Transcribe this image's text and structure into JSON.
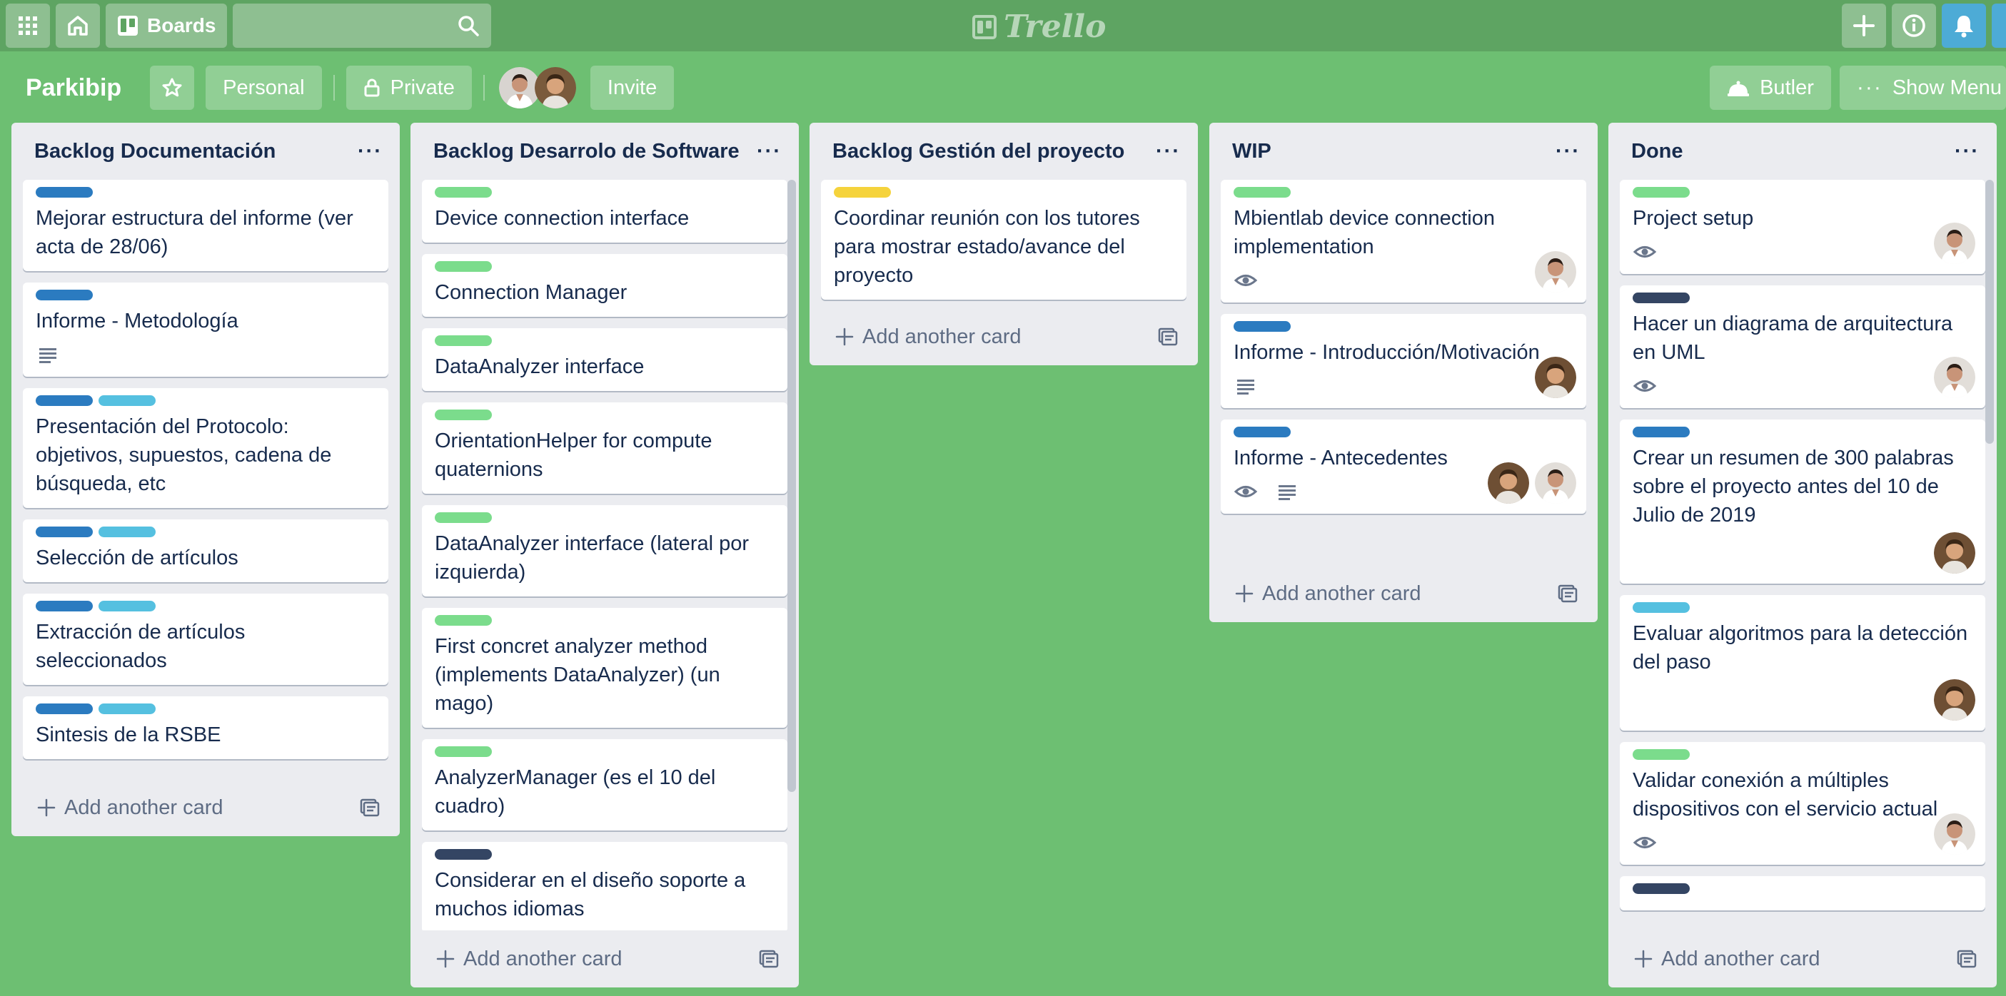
{
  "topbar": {
    "boards_label": "Boards",
    "logo_text": "Trello",
    "icons": [
      "apps-icon",
      "home-icon",
      "boards-icon",
      "search-icon",
      "plus-icon",
      "info-icon",
      "bell-icon"
    ]
  },
  "board": {
    "name": "Parkibip",
    "team_label": "Personal",
    "visibility_label": "Private",
    "invite_label": "Invite",
    "butler_label": "Butler",
    "show_menu_label": "Show Menu",
    "background_color": "#6dbf72"
  },
  "label_colors": {
    "blue": "#0079bf",
    "green": "#61bd4f",
    "sky": "#00c2e0",
    "yellow": "#f2d600",
    "navy": "#344563"
  },
  "lists": [
    {
      "title": "Backlog Documentación",
      "add_label": "Add another card",
      "cards": [
        {
          "labels": [
            "#2b7bc0"
          ],
          "text": "Mejorar estructura del informe (ver acta de 28/06)",
          "badges": [],
          "avatars": []
        },
        {
          "labels": [
            "#2b7bc0"
          ],
          "text": "Informe - Metodología",
          "badges": [
            "description-icon"
          ],
          "avatars": []
        },
        {
          "labels": [
            "#2b7bc0",
            "#55c0e0"
          ],
          "text": "Presentación del Protocolo: objetivos, supuestos, cadena de búsqueda, etc",
          "badges": [],
          "avatars": []
        },
        {
          "labels": [
            "#2b7bc0",
            "#55c0e0"
          ],
          "text": "Selección de artículos",
          "badges": [],
          "avatars": []
        },
        {
          "labels": [
            "#2b7bc0",
            "#55c0e0"
          ],
          "text": "Extracción de artículos seleccionados",
          "badges": [],
          "avatars": []
        },
        {
          "labels": [
            "#2b7bc0",
            "#55c0e0"
          ],
          "text": "Sintesis de la RSBE",
          "badges": [],
          "avatars": []
        }
      ]
    },
    {
      "title": "Backlog Desarrolo de Software",
      "add_label": "Add another card",
      "cards": [
        {
          "labels": [
            "#7bdc8c"
          ],
          "text": "Device connection interface",
          "badges": [],
          "avatars": []
        },
        {
          "labels": [
            "#7bdc8c"
          ],
          "text": "Connection Manager",
          "badges": [],
          "avatars": []
        },
        {
          "labels": [
            "#7bdc8c"
          ],
          "text": "DataAnalyzer interface",
          "badges": [],
          "avatars": []
        },
        {
          "labels": [
            "#7bdc8c"
          ],
          "text": "OrientationHelper for compute quaternions",
          "badges": [],
          "avatars": []
        },
        {
          "labels": [
            "#7bdc8c"
          ],
          "text": "DataAnalyzer interface (lateral por izquierda)",
          "badges": [],
          "avatars": []
        },
        {
          "labels": [
            "#7bdc8c"
          ],
          "text": "First concret analyzer method (implements DataAnalyzer) (un mago)",
          "badges": [],
          "avatars": []
        },
        {
          "labels": [
            "#7bdc8c"
          ],
          "text": "AnalyzerManager (es el 10 del cuadro)",
          "badges": [],
          "avatars": []
        },
        {
          "labels": [
            "#344563"
          ],
          "text": "Considerar en el diseño soporte a muchos idiomas",
          "badges": [],
          "avatars": []
        }
      ]
    },
    {
      "title": "Backlog Gestión del proyecto",
      "add_label": "Add another card",
      "cards": [
        {
          "labels": [
            "#f5d33c"
          ],
          "text": "Coordinar reunión con los tutores para mostrar estado/avance del proyecto",
          "badges": [],
          "avatars": []
        }
      ]
    },
    {
      "title": "WIP",
      "add_label": "Add another card",
      "cards": [
        {
          "labels": [
            "#7bdc8c"
          ],
          "text": "Mbientlab device connection implementation",
          "badges": [
            "watch-icon"
          ],
          "avatars": [
            "a"
          ]
        },
        {
          "labels": [
            "#2b7bc0"
          ],
          "text": "Informe - Introducción/Motivación",
          "badges": [
            "description-icon"
          ],
          "avatars": [
            "b"
          ]
        },
        {
          "labels": [
            "#2b7bc0"
          ],
          "text": "Informe - Antecedentes",
          "badges": [
            "watch-icon",
            "description-icon"
          ],
          "avatars": [
            "b",
            "a"
          ]
        }
      ]
    },
    {
      "title": "Done",
      "add_label": "Add another card",
      "cards": [
        {
          "labels": [
            "#7bdc8c"
          ],
          "text": "Project setup",
          "badges": [
            "watch-icon"
          ],
          "avatars": [
            "a"
          ]
        },
        {
          "labels": [
            "#344563"
          ],
          "text": "Hacer un diagrama de arquitectura en UML",
          "badges": [
            "watch-icon"
          ],
          "avatars": [
            "a"
          ]
        },
        {
          "labels": [
            "#2b7bc0"
          ],
          "text": "Crear un resumen de 300 palabras sobre el proyecto antes del 10 de Julio de 2019",
          "badges": [],
          "avatars": [
            "b"
          ]
        },
        {
          "labels": [
            "#55c0e0"
          ],
          "text": "Evaluar algoritmos para la detección del paso",
          "badges": [],
          "avatars": [
            "b"
          ]
        },
        {
          "labels": [
            "#7bdc8c"
          ],
          "text": "Validar conexión a múltiples dispositivos con el servicio actual",
          "badges": [
            "watch-icon"
          ],
          "avatars": [
            "a"
          ]
        },
        {
          "labels": [
            "#344563"
          ],
          "text": "",
          "badges": [],
          "avatars": []
        }
      ]
    }
  ]
}
